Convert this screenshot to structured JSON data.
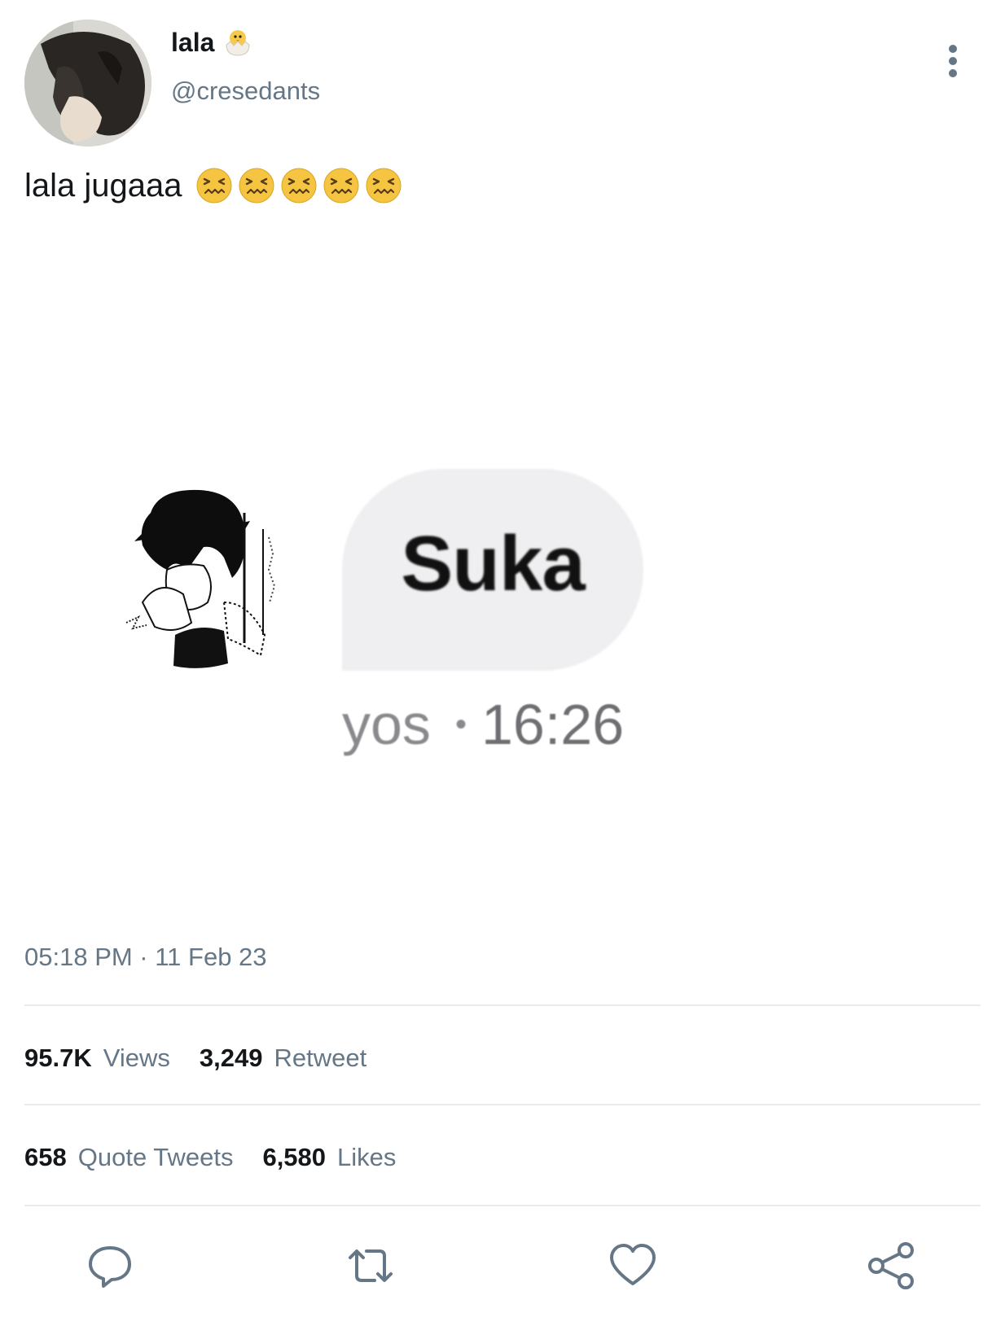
{
  "user": {
    "display_name": "lala",
    "handle": "@cresedants",
    "name_emoji": "hatching-chick"
  },
  "tweet": {
    "text": "lala jugaaa",
    "emoji_name": "confounded-face",
    "emoji_count": 5,
    "timestamp": "05:18 PM · 11 Feb 23"
  },
  "media": {
    "message_text": "Suka",
    "sender": "yos",
    "separator": "•",
    "time": "16:26"
  },
  "stats": {
    "views_count": "95.7K",
    "views_label": "Views",
    "retweets_count": "3,249",
    "retweets_label": "Retweet",
    "quotes_count": "658",
    "quotes_label": "Quote Tweets",
    "likes_count": "6,580",
    "likes_label": "Likes"
  },
  "actions": {
    "reply_icon": "reply-icon",
    "retweet_icon": "retweet-icon",
    "like_icon": "heart-icon",
    "share_icon": "share-icon"
  },
  "colors": {
    "secondary_text": "#657786",
    "icon": "#657786",
    "bubble": "#efeff1",
    "emoji_face": "#f5c542"
  }
}
